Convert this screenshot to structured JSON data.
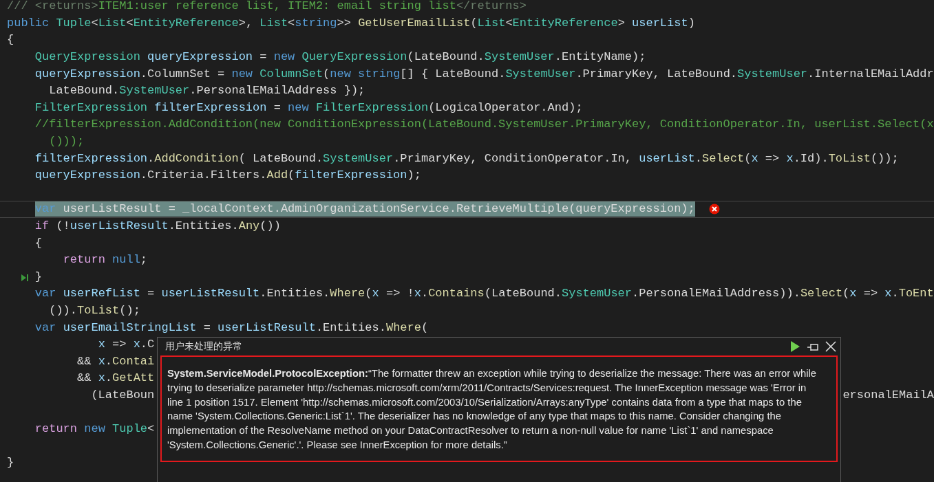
{
  "editor": {
    "lines": [
      {
        "kind": "code",
        "highlighted": false,
        "error": false,
        "step": false,
        "tokens": [
          {
            "text": "/// <returns>",
            "kind": "doc_tag"
          },
          {
            "text": "ITEM1:user reference list, ITEM2: email string list",
            "kind": "comment"
          },
          {
            "text": "</returns>",
            "kind": "doc_tag"
          }
        ]
      },
      {
        "kind": "code",
        "highlighted": false,
        "error": false,
        "step": false,
        "tokens": [
          {
            "text": "public ",
            "kind": "keyword"
          },
          {
            "text": "Tuple",
            "kind": "type"
          },
          {
            "text": "<",
            "kind": "plain"
          },
          {
            "text": "List",
            "kind": "type"
          },
          {
            "text": "<",
            "kind": "plain"
          },
          {
            "text": "EntityReference",
            "kind": "type"
          },
          {
            "text": ">, ",
            "kind": "plain"
          },
          {
            "text": "List",
            "kind": "type"
          },
          {
            "text": "<",
            "kind": "plain"
          },
          {
            "text": "string",
            "kind": "keyword"
          },
          {
            "text": ">> ",
            "kind": "plain"
          },
          {
            "text": "GetUserEmailList",
            "kind": "method"
          },
          {
            "text": "(",
            "kind": "plain"
          },
          {
            "text": "List",
            "kind": "type"
          },
          {
            "text": "<",
            "kind": "plain"
          },
          {
            "text": "EntityReference",
            "kind": "type"
          },
          {
            "text": "> ",
            "kind": "plain"
          },
          {
            "text": "userList",
            "kind": "variable"
          },
          {
            "text": ")",
            "kind": "plain"
          }
        ]
      },
      {
        "kind": "code",
        "highlighted": false,
        "error": false,
        "step": false,
        "tokens": [
          {
            "text": "{",
            "kind": "plain"
          }
        ]
      },
      {
        "kind": "code",
        "highlighted": false,
        "error": false,
        "step": false,
        "tokens": [
          {
            "text": "    QueryExpression ",
            "kind": "type"
          },
          {
            "text": "queryExpression",
            "kind": "variable"
          },
          {
            "text": " = ",
            "kind": "plain"
          },
          {
            "text": "new ",
            "kind": "keyword"
          },
          {
            "text": "QueryExpression",
            "kind": "type"
          },
          {
            "text": "(LateBound.",
            "kind": "plain"
          },
          {
            "text": "SystemUser",
            "kind": "type"
          },
          {
            "text": ".EntityName);",
            "kind": "plain"
          }
        ]
      },
      {
        "kind": "code",
        "highlighted": false,
        "error": false,
        "step": false,
        "tokens": [
          {
            "text": "    queryExpression",
            "kind": "variable"
          },
          {
            "text": ".ColumnSet = ",
            "kind": "plain"
          },
          {
            "text": "new ",
            "kind": "keyword"
          },
          {
            "text": "ColumnSet",
            "kind": "type"
          },
          {
            "text": "(",
            "kind": "plain"
          },
          {
            "text": "new string",
            "kind": "keyword"
          },
          {
            "text": "[] { LateBound.",
            "kind": "plain"
          },
          {
            "text": "SystemUser",
            "kind": "type"
          },
          {
            "text": ".PrimaryKey, LateBound.",
            "kind": "plain"
          },
          {
            "text": "SystemUser",
            "kind": "type"
          },
          {
            "text": ".InternalEMailAddr",
            "kind": "plain"
          }
        ]
      },
      {
        "kind": "code",
        "highlighted": false,
        "error": false,
        "step": false,
        "tokens": [
          {
            "text": "      LateBound.",
            "kind": "plain"
          },
          {
            "text": "SystemUser",
            "kind": "type"
          },
          {
            "text": ".PersonalEMailAddress });",
            "kind": "plain"
          }
        ]
      },
      {
        "kind": "code",
        "highlighted": false,
        "error": false,
        "step": false,
        "tokens": [
          {
            "text": "    FilterExpression ",
            "kind": "type"
          },
          {
            "text": "filterExpression",
            "kind": "variable"
          },
          {
            "text": " = ",
            "kind": "plain"
          },
          {
            "text": "new ",
            "kind": "keyword"
          },
          {
            "text": "FilterExpression",
            "kind": "type"
          },
          {
            "text": "(LogicalOperator.And);",
            "kind": "plain"
          }
        ]
      },
      {
        "kind": "code",
        "highlighted": false,
        "error": false,
        "step": false,
        "tokens": [
          {
            "text": "    //filterExpression.AddCondition(new ConditionExpression(LateBound.SystemUser.PrimaryKey, ConditionOperator.In, userList.Select(x",
            "kind": "comment"
          }
        ]
      },
      {
        "kind": "code",
        "highlighted": false,
        "error": false,
        "step": false,
        "tokens": [
          {
            "text": "      ()));",
            "kind": "comment"
          }
        ]
      },
      {
        "kind": "code",
        "highlighted": false,
        "error": false,
        "step": false,
        "tokens": [
          {
            "text": "    filterExpression",
            "kind": "variable"
          },
          {
            "text": ".",
            "kind": "plain"
          },
          {
            "text": "AddCondition",
            "kind": "method"
          },
          {
            "text": "( LateBound.",
            "kind": "plain"
          },
          {
            "text": "SystemUser",
            "kind": "type"
          },
          {
            "text": ".PrimaryKey, ConditionOperator.In, ",
            "kind": "plain"
          },
          {
            "text": "userList",
            "kind": "variable"
          },
          {
            "text": ".",
            "kind": "plain"
          },
          {
            "text": "Select",
            "kind": "method"
          },
          {
            "text": "(",
            "kind": "plain"
          },
          {
            "text": "x",
            "kind": "variable"
          },
          {
            "text": " => ",
            "kind": "plain"
          },
          {
            "text": "x",
            "kind": "variable"
          },
          {
            "text": ".Id).",
            "kind": "plain"
          },
          {
            "text": "ToList",
            "kind": "method"
          },
          {
            "text": "());",
            "kind": "plain"
          }
        ]
      },
      {
        "kind": "code",
        "highlighted": false,
        "error": false,
        "step": false,
        "tokens": [
          {
            "text": "    queryExpression",
            "kind": "variable"
          },
          {
            "text": ".Criteria.Filters.",
            "kind": "plain"
          },
          {
            "text": "Add",
            "kind": "method"
          },
          {
            "text": "(",
            "kind": "plain"
          },
          {
            "text": "filterExpression",
            "kind": "variable"
          },
          {
            "text": ");",
            "kind": "plain"
          }
        ]
      },
      {
        "kind": "blank"
      },
      {
        "kind": "code",
        "highlighted": true,
        "error": true,
        "step": false,
        "tokens": [
          {
            "text": "    var",
            "kind": "keyword"
          },
          {
            "text": " userListResult = _localContext.AdminOrganizationService.RetrieveMultiple(queryExpression);",
            "kind": "plain"
          }
        ]
      },
      {
        "kind": "code",
        "highlighted": false,
        "error": false,
        "step": false,
        "tokens": [
          {
            "text": "    if",
            "kind": "control"
          },
          {
            "text": " (!",
            "kind": "plain"
          },
          {
            "text": "userListResult",
            "kind": "variable"
          },
          {
            "text": ".Entities.",
            "kind": "plain"
          },
          {
            "text": "Any",
            "kind": "method"
          },
          {
            "text": "())",
            "kind": "plain"
          }
        ]
      },
      {
        "kind": "code",
        "highlighted": false,
        "error": false,
        "step": false,
        "tokens": [
          {
            "text": "    {",
            "kind": "plain"
          }
        ]
      },
      {
        "kind": "code",
        "highlighted": false,
        "error": false,
        "step": false,
        "tokens": [
          {
            "text": "        return ",
            "kind": "control"
          },
          {
            "text": "null",
            "kind": "keyword"
          },
          {
            "text": ";",
            "kind": "plain"
          }
        ]
      },
      {
        "kind": "code",
        "highlighted": false,
        "error": false,
        "step": true,
        "tokens": [
          {
            "text": "    }",
            "kind": "plain"
          }
        ]
      },
      {
        "kind": "code",
        "highlighted": false,
        "error": false,
        "step": false,
        "tokens": [
          {
            "text": "    var ",
            "kind": "keyword"
          },
          {
            "text": "userRefList",
            "kind": "variable"
          },
          {
            "text": " = ",
            "kind": "plain"
          },
          {
            "text": "userListResult",
            "kind": "variable"
          },
          {
            "text": ".Entities.",
            "kind": "plain"
          },
          {
            "text": "Where",
            "kind": "method"
          },
          {
            "text": "(",
            "kind": "plain"
          },
          {
            "text": "x",
            "kind": "variable"
          },
          {
            "text": " => !",
            "kind": "plain"
          },
          {
            "text": "x",
            "kind": "variable"
          },
          {
            "text": ".",
            "kind": "plain"
          },
          {
            "text": "Contains",
            "kind": "method"
          },
          {
            "text": "(LateBound.",
            "kind": "plain"
          },
          {
            "text": "SystemUser",
            "kind": "type"
          },
          {
            "text": ".PersonalEMailAddress)).",
            "kind": "plain"
          },
          {
            "text": "Select",
            "kind": "method"
          },
          {
            "text": "(",
            "kind": "plain"
          },
          {
            "text": "x",
            "kind": "variable"
          },
          {
            "text": " => ",
            "kind": "plain"
          },
          {
            "text": "x",
            "kind": "variable"
          },
          {
            "text": ".",
            "kind": "plain"
          },
          {
            "text": "ToEnt",
            "kind": "method"
          }
        ]
      },
      {
        "kind": "code",
        "highlighted": false,
        "error": false,
        "step": false,
        "tokens": [
          {
            "text": "      ()).",
            "kind": "plain"
          },
          {
            "text": "ToList",
            "kind": "method"
          },
          {
            "text": "();",
            "kind": "plain"
          }
        ]
      },
      {
        "kind": "code",
        "highlighted": false,
        "error": false,
        "step": false,
        "tokens": [
          {
            "text": "    var ",
            "kind": "keyword"
          },
          {
            "text": "userEmailStringList",
            "kind": "variable"
          },
          {
            "text": " = ",
            "kind": "plain"
          },
          {
            "text": "userListResult",
            "kind": "variable"
          },
          {
            "text": ".Entities.",
            "kind": "plain"
          },
          {
            "text": "Where",
            "kind": "method"
          },
          {
            "text": "(",
            "kind": "plain"
          }
        ]
      },
      {
        "kind": "code",
        "highlighted": false,
        "error": false,
        "step": false,
        "tokens": [
          {
            "text": "             x",
            "kind": "variable"
          },
          {
            "text": " => ",
            "kind": "plain"
          },
          {
            "text": "x",
            "kind": "variable"
          },
          {
            "text": ".C",
            "kind": "plain"
          }
        ]
      },
      {
        "kind": "code",
        "highlighted": false,
        "error": false,
        "step": false,
        "tokens": [
          {
            "text": "          && ",
            "kind": "plain"
          },
          {
            "text": "x",
            "kind": "variable"
          },
          {
            "text": ".",
            "kind": "plain"
          },
          {
            "text": "Contai",
            "kind": "method"
          }
        ]
      },
      {
        "kind": "code",
        "highlighted": false,
        "error": false,
        "step": false,
        "tokens": [
          {
            "text": "          && ",
            "kind": "plain"
          },
          {
            "text": "x",
            "kind": "variable"
          },
          {
            "text": ".",
            "kind": "plain"
          },
          {
            "text": "GetAtt",
            "kind": "method"
          }
        ]
      },
      {
        "kind": "code",
        "highlighted": false,
        "error": false,
        "step": false,
        "tokens": [
          {
            "text": "            (LateBoun",
            "kind": "plain"
          }
        ],
        "tail": "ersonalEMailA"
      },
      {
        "kind": "blank"
      },
      {
        "kind": "code",
        "highlighted": false,
        "error": false,
        "step": false,
        "tokens": [
          {
            "text": "    return ",
            "kind": "control"
          },
          {
            "text": "new ",
            "kind": "keyword"
          },
          {
            "text": "Tuple",
            "kind": "type"
          },
          {
            "text": "<",
            "kind": "plain"
          }
        ]
      },
      {
        "kind": "blank"
      },
      {
        "kind": "code",
        "highlighted": false,
        "error": false,
        "step": false,
        "tokens": [
          {
            "text": "}",
            "kind": "plain"
          }
        ]
      }
    ]
  },
  "exception_popup": {
    "title": "用户未处理的异常",
    "message": "**System.ServiceModel.ProtocolException:**“The formatter threw an exception while trying to deserialize the message: There was an error while trying to deserialize parameter http://schemas.microsoft.com/xrm/2011/Contracts/Services:request. The InnerException message was 'Error in line 1 position 1517. Element 'http://schemas.microsoft.com/2003/10/Serialization/Arrays:anyType' contains data from a type that maps to the name 'System.Collections.Generic:List`1'. The deserializer has no knowledge of any type that maps to this name. Consider changing the implementation of the ResolveName method on your DataContractResolver to return a non-null value for name 'List`1' and namespace 'System.Collections.Generic'.'.  Please see InnerException for more details.”"
  }
}
